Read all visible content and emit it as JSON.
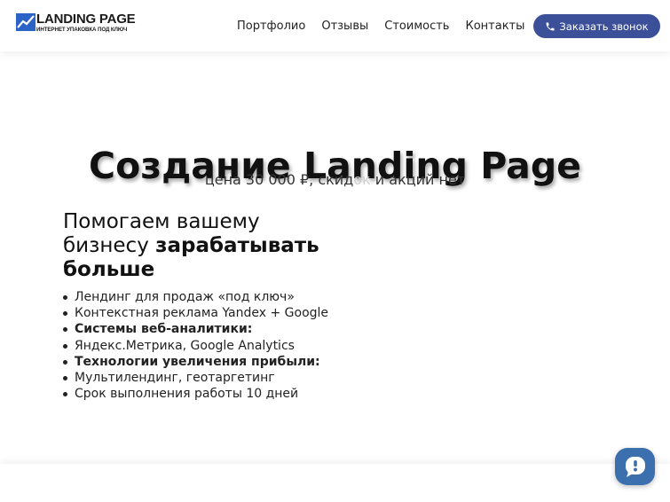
{
  "header": {
    "logo_title": "LANDING PAGE",
    "logo_subtitle": "ИНТЕРНЕТ УПАКОВКА ПОД КЛЮЧ",
    "nav": [
      "Портфолио",
      "Отзывы",
      "Стоимость",
      "Контакты"
    ],
    "call_button": "Заказать звонок"
  },
  "hero": {
    "title": "Создание Landing Page",
    "subtitle_before": "цена 30 000 ₽, скид",
    "subtitle_faded": "ок",
    "subtitle_after": " и акций нет"
  },
  "lead": {
    "normal": "Помогаем вашему бизнесу ",
    "bold": "зарабатывать больше"
  },
  "features": [
    {
      "text": "Лендинг для продаж «под ключ»",
      "bold": false
    },
    {
      "text": "Контекстная реклама Yandex + Google",
      "bold": false
    },
    {
      "text": "Системы веб-аналитики:",
      "bold": true
    },
    {
      "text": "Яндекс.Метрика, Google Analytics",
      "bold": false
    },
    {
      "text": "Технологии увеличения прибыли:",
      "bold": true
    },
    {
      "text": "Мультилендинг, геотаргетинг",
      "bold": false
    },
    {
      "text": "Срок выполнения работы 10 дней",
      "bold": false
    }
  ],
  "icons": {
    "logo": "trend-chart-icon",
    "call": "phone-icon",
    "chat": "chat-bubble-icon"
  },
  "colors": {
    "accent": "#3c5099",
    "chat": "#3c6fae",
    "logo_blue": "#2b63c6"
  }
}
